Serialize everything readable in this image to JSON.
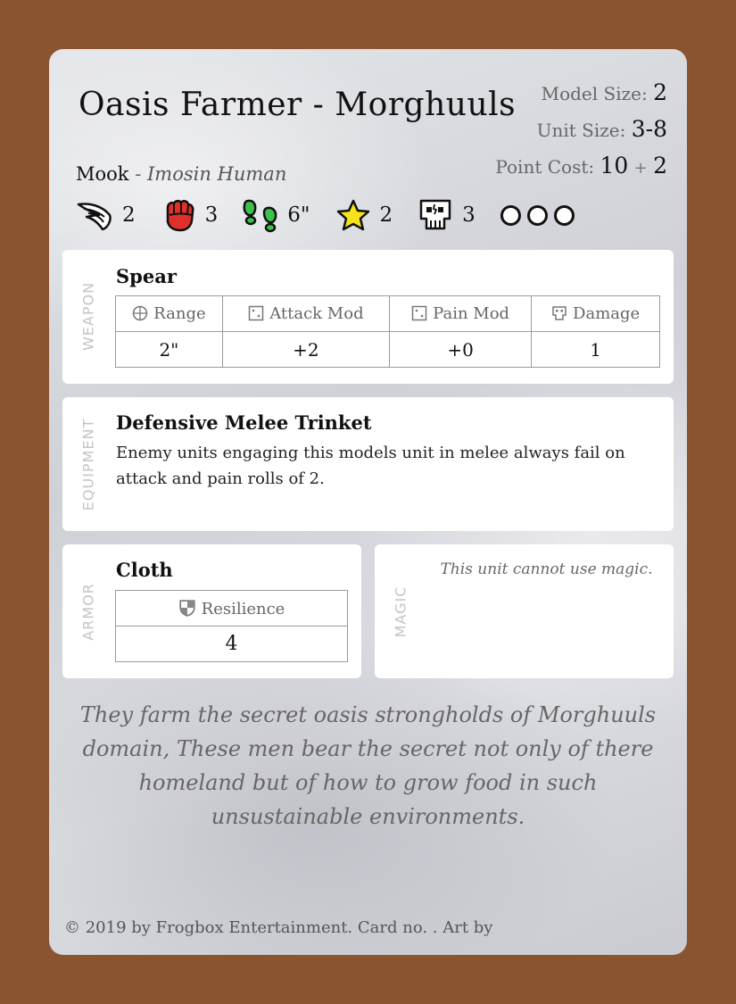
{
  "card": {
    "title": "Oasis Farmer - Morghuuls",
    "class": "Mook",
    "separator": "-",
    "race": "Imosin Human",
    "model_size_label": "Model Size:",
    "model_size": "2",
    "unit_size_label": "Unit Size:",
    "unit_size": "3-8",
    "point_cost_label": "Point Cost:",
    "point_cost_base": "10",
    "point_cost_plus": "+",
    "point_cost_extra": "2"
  },
  "stats": {
    "wing": "2",
    "fist": "3",
    "move": "6\"",
    "star": "2",
    "skull": "3",
    "slots": 3
  },
  "weapon": {
    "section_label": "WEAPON",
    "name": "Spear",
    "headers": [
      "Range",
      "Attack Mod",
      "Pain Mod",
      "Damage"
    ],
    "values": [
      "2\"",
      "+2",
      "+0",
      "1"
    ]
  },
  "equipment": {
    "section_label": "EQUIPMENT",
    "name": "Defensive Melee Trinket",
    "text": "Enemy units engaging this models unit in melee always fail on attack and pain rolls of 2."
  },
  "armor": {
    "section_label": "ARMOR",
    "name": "Cloth",
    "header": "Resilience",
    "value": "4"
  },
  "magic": {
    "section_label": "MAGIC",
    "text": "This unit cannot use magic."
  },
  "flavor": "They farm the secret oasis strongholds of Morghuuls domain, These men bear the secret not only of there homeland but of how to grow food in such unsustainable environments.",
  "copyright": "© 2019 by Frogbox Entertainment. Card no. . Art by",
  "colors": {
    "background": "#8b5430",
    "fist": "#e0302a",
    "boots": "#3cc24a",
    "star": "#f5e21a"
  }
}
